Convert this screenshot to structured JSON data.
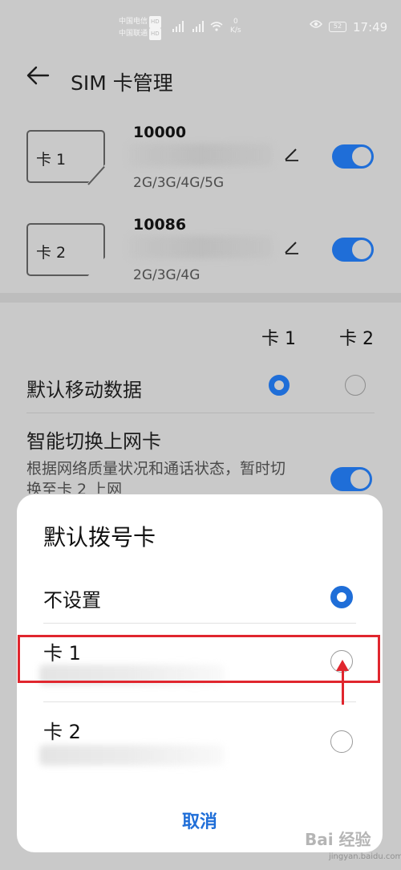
{
  "status_bar": {
    "carrier1": "中国电信",
    "carrier2": "中国联通",
    "hd": "HD",
    "speed_value": "0",
    "speed_unit": "K/s",
    "battery": "52",
    "time": "17:49"
  },
  "header": {
    "title": "SIM 卡管理"
  },
  "sims": [
    {
      "label": "卡 1",
      "number": "10000",
      "network": "2G/3G/4G/5G"
    },
    {
      "label": "卡 2",
      "number": "10086",
      "network": "2G/3G/4G"
    }
  ],
  "columns": {
    "card1": "卡 1",
    "card2": "卡 2"
  },
  "settings": {
    "default_data": "默认移动数据",
    "smart_switch": "智能切换上网卡",
    "smart_switch_desc": "根据网络质量状况和通话状态，暂时切换至卡 2 上网"
  },
  "dialog": {
    "title": "默认拨号卡",
    "options": [
      {
        "label": "不设置",
        "selected": true
      },
      {
        "label": "卡 1",
        "selected": false
      },
      {
        "label": "卡 2",
        "selected": false
      }
    ],
    "cancel": "取消"
  },
  "colors": {
    "accent": "#1f6ed8",
    "annotation": "#e0262e"
  },
  "watermark": {
    "main": "Bai 经验",
    "sub": "jingyan.baidu.com"
  }
}
